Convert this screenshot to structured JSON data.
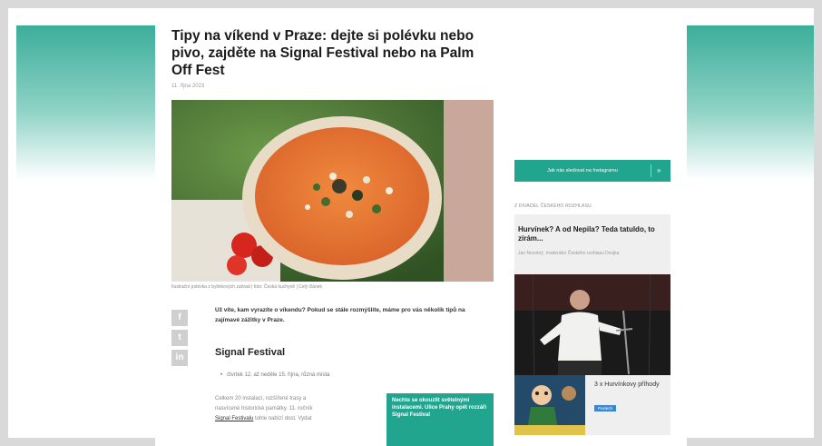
{
  "article": {
    "title": "Tipy na víkend v Praze: dejte si polévku nebo pivo, zajděte na Signal Festival nebo na Palm Off Fest",
    "date": "11. října 2023",
    "photo_caption": "Ilustrační polévka z bylinkových zahrad | foto: Česká kuchyně | Celý článek",
    "intro": "Už víte, kam vyrazíte o víkendu? Pokud se stále rozmýšlíte, máme pro vás několik tipů na zajímavé zážitky v Praze.",
    "section_heading": "Signal Festival",
    "bullet": "čtvrtek 12. až neděle 15. října, různá místa",
    "body_lines": [
      "Celkem 20 instalací, rozšířené trasy a",
      "nasvícené historické památky. 11. ročník",
      "Signal Festivalu tohle nabízí dost. Vydat"
    ],
    "body_link": "Signal Festivalu",
    "promo_text": "Nechte se okouzlit světelnými instalacemi. Ulice Prahy opět rozzáří Signal Festival"
  },
  "share": {
    "facebook": "f",
    "twitter": "t",
    "linkedin": "in"
  },
  "sidebar": {
    "subscribe_label": "Jak nás sledovat na Instagramu",
    "subscribe_arrow": "»",
    "section_heading": "Z DIVADEL ČESKÉHO ROZHLASU",
    "card_title": "Hurvínek? A od Nepila? Teda tatuldo, to zírám...",
    "card_sub": "Jan Novotný, moderátor Českého rozhlasu Dvojka",
    "card2_title": "3 x Hurvínkovy příhody",
    "card2_badge": "Poslech"
  },
  "colors": {
    "accent": "#22a58f",
    "badge": "#3a86d1"
  }
}
